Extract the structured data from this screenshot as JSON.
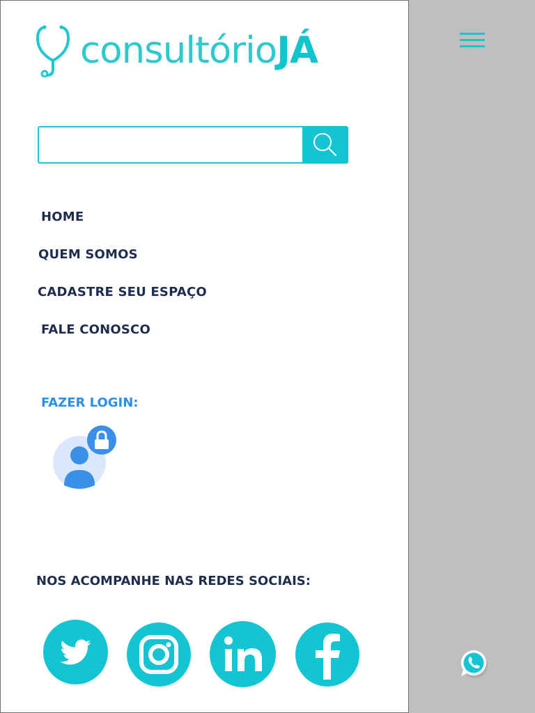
{
  "brand": {
    "logo_light": "consultório",
    "logo_bold": "JÁ",
    "logo_icon": "stethoscope-icon",
    "accent_color": "#13c5d3"
  },
  "search": {
    "placeholder": "",
    "value": "",
    "button_icon": "search-icon"
  },
  "nav": {
    "home": "HOME",
    "about": "QUEM SOMOS",
    "register": "CADASTRE SEU ESPAÇO",
    "contact": "FALE CONOSCO"
  },
  "login": {
    "label": "FAZER LOGIN:",
    "icon": "user-lock-icon",
    "color": "#2a8fe6"
  },
  "social": {
    "label": "NOS ACOMPANHE NAS REDES SOCIAIS:",
    "networks": [
      "twitter-icon",
      "instagram-icon",
      "linkedin-icon",
      "facebook-icon"
    ]
  },
  "menu": {
    "icon": "hamburger-menu-icon"
  },
  "chat": {
    "icon": "whatsapp-icon"
  }
}
